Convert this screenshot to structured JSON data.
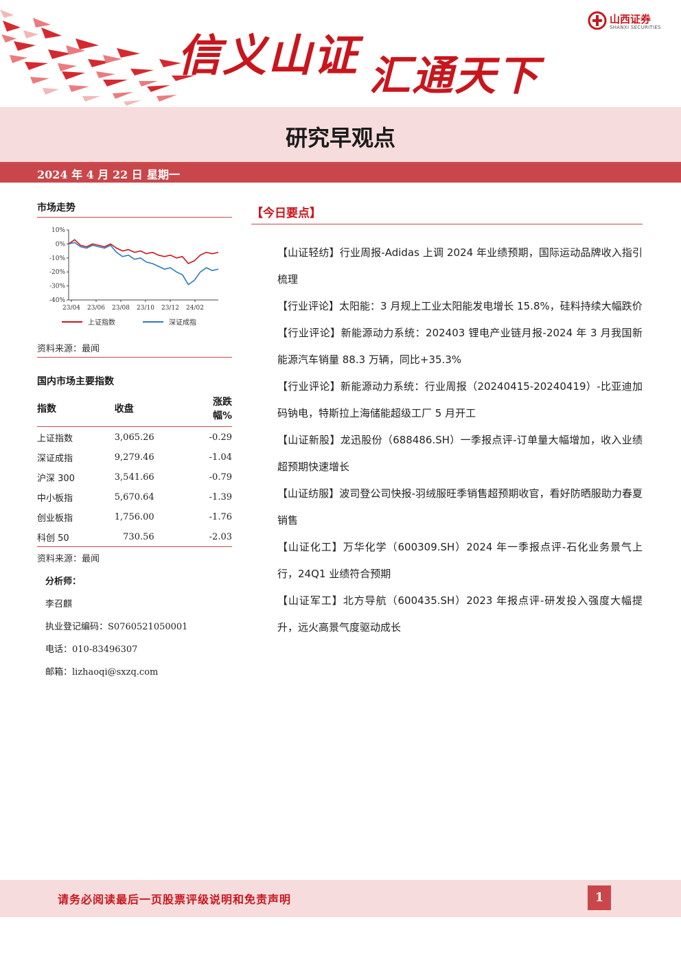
{
  "header": {
    "slogan_part1": "信义山证",
    "slogan_part2": "汇通天下",
    "logo_cn": "山西证券",
    "logo_en": "SHANXI SECURITIES",
    "doc_title": "研究早观点",
    "date": "2024 年 4 月 22 日",
    "weekday": "星期一"
  },
  "market_trend": {
    "heading": "市场走势",
    "source": "资料来源：最闻"
  },
  "chart_data": {
    "type": "line",
    "title": "",
    "xlabel": "",
    "ylabel": "",
    "y_ticks": [
      "10%",
      "0%",
      "-10%",
      "-20%",
      "-30%",
      "-40%"
    ],
    "ylim": [
      -40,
      10
    ],
    "x_ticks": [
      "23/04",
      "23/06",
      "23/08",
      "23/10",
      "23/12",
      "24/02"
    ],
    "x": [
      0,
      1,
      2,
      3,
      4,
      5,
      6,
      7,
      8,
      9,
      10,
      11,
      12,
      13,
      14,
      15,
      16,
      17,
      18,
      19,
      20,
      21,
      22,
      23,
      24,
      25
    ],
    "series": [
      {
        "name": "上证指数",
        "color": "#c8161d",
        "values": [
          0,
          3,
          -1,
          -2,
          0,
          -1,
          -2,
          0,
          -3,
          -5,
          -4,
          -6,
          -5,
          -7,
          -6,
          -8,
          -9,
          -8,
          -10,
          -9,
          -14,
          -12,
          -8,
          -6,
          -7,
          -6
        ]
      },
      {
        "name": "深证成指",
        "color": "#2b78c2",
        "values": [
          0,
          1,
          -2,
          -3,
          -1,
          -2,
          -3,
          -1,
          -6,
          -9,
          -8,
          -11,
          -10,
          -13,
          -14,
          -16,
          -18,
          -17,
          -20,
          -22,
          -29,
          -26,
          -20,
          -17,
          -19,
          -18
        ]
      }
    ],
    "legend": "bottom"
  },
  "indices": {
    "heading": "国内市场主要指数",
    "columns": [
      "指数",
      "收盘",
      "涨跌幅%"
    ],
    "rows": [
      {
        "name": "上证指数",
        "close": "3,065.26",
        "change": "-0.29"
      },
      {
        "name": "深证成指",
        "close": "9,279.46",
        "change": "-1.04"
      },
      {
        "name": "沪深 300",
        "close": "3,541.66",
        "change": "-0.79"
      },
      {
        "name": "中小板指",
        "close": "5,670.64",
        "change": "-1.39"
      },
      {
        "name": "创业板指",
        "close": "1,756.00",
        "change": "-1.76"
      },
      {
        "name": "科创 50",
        "close": "730.56",
        "change": "-2.03"
      }
    ],
    "source": "资料来源：最闻"
  },
  "analyst": {
    "heading": "分析师：",
    "name": "李召麒",
    "reg_label": "执业登记编码：",
    "reg_value": "S0760521050001",
    "phone_label": "电话：",
    "phone_value": "010-83496307",
    "email_label": "邮箱：",
    "email_value": "lizhaoqi@sxzq.com"
  },
  "key_points": {
    "heading": "【今日要点】",
    "items": [
      {
        "tag": "【山证轻纺】",
        "text": "行业周报-Adidas 上调 2024 年业绩预期，国际运动品牌收入指引梳理"
      },
      {
        "tag": "【行业评论】",
        "text": "太阳能：3 月规上工业太阳能发电增长 15.8%，硅料持续大幅跌价"
      },
      {
        "tag": "【行业评论】",
        "text": "新能源动力系统：202403 锂电产业链月报-2024 年 3 月我国新能源汽车销量 88.3 万辆，同比+35.3%"
      },
      {
        "tag": "【行业评论】",
        "text": "新能源动力系统：行业周报（20240415-20240419）-比亚迪加码钠电，特斯拉上海储能超级工厂 5 月开工"
      },
      {
        "tag": "【山证新股】",
        "text": "龙迅股份（688486.SH）一季报点评-订单量大幅增加，收入业绩超预期快速增长"
      },
      {
        "tag": "【山证纺服】",
        "text": "波司登公司快报-羽绒服旺季销售超预期收官，看好防晒服助力春夏销售"
      },
      {
        "tag": "【山证化工】",
        "text": "万华化学（600309.SH）2024 年一季报点评-石化业务景气上行，24Q1 业绩符合预期"
      },
      {
        "tag": "【山证军工】",
        "text": "北方导航（600435.SH）2023 年报点评-研发投入强度大幅提升，远火高景气度驱动成长"
      }
    ]
  },
  "footer": {
    "disclaimer": "请务必阅读最后一页股票评级说明和免责声明",
    "page_number": "1"
  }
}
